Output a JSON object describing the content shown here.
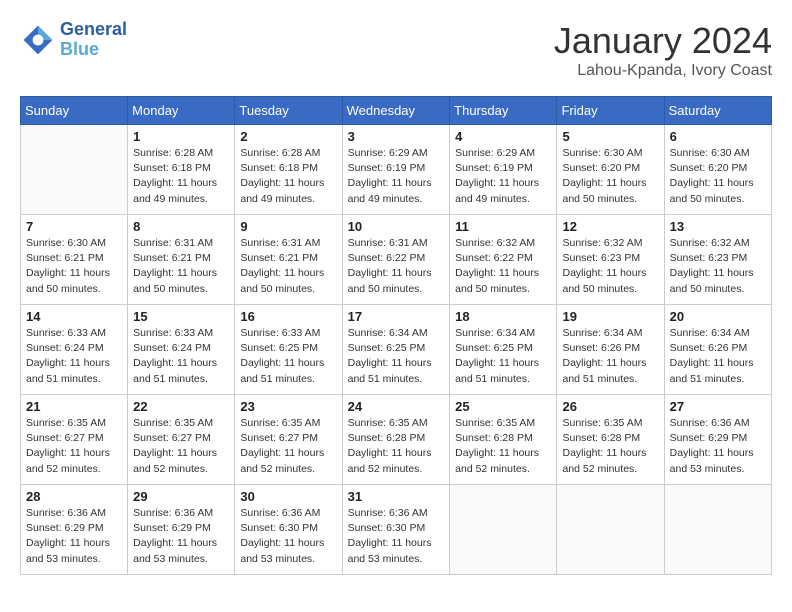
{
  "header": {
    "logo_line1": "General",
    "logo_line2": "Blue",
    "month_title": "January 2024",
    "location": "Lahou-Kpanda, Ivory Coast"
  },
  "weekdays": [
    "Sunday",
    "Monday",
    "Tuesday",
    "Wednesday",
    "Thursday",
    "Friday",
    "Saturday"
  ],
  "weeks": [
    [
      {
        "day": "",
        "info": ""
      },
      {
        "day": "1",
        "info": "Sunrise: 6:28 AM\nSunset: 6:18 PM\nDaylight: 11 hours\nand 49 minutes."
      },
      {
        "day": "2",
        "info": "Sunrise: 6:28 AM\nSunset: 6:18 PM\nDaylight: 11 hours\nand 49 minutes."
      },
      {
        "day": "3",
        "info": "Sunrise: 6:29 AM\nSunset: 6:19 PM\nDaylight: 11 hours\nand 49 minutes."
      },
      {
        "day": "4",
        "info": "Sunrise: 6:29 AM\nSunset: 6:19 PM\nDaylight: 11 hours\nand 49 minutes."
      },
      {
        "day": "5",
        "info": "Sunrise: 6:30 AM\nSunset: 6:20 PM\nDaylight: 11 hours\nand 50 minutes."
      },
      {
        "day": "6",
        "info": "Sunrise: 6:30 AM\nSunset: 6:20 PM\nDaylight: 11 hours\nand 50 minutes."
      }
    ],
    [
      {
        "day": "7",
        "info": "Sunrise: 6:30 AM\nSunset: 6:21 PM\nDaylight: 11 hours\nand 50 minutes."
      },
      {
        "day": "8",
        "info": "Sunrise: 6:31 AM\nSunset: 6:21 PM\nDaylight: 11 hours\nand 50 minutes."
      },
      {
        "day": "9",
        "info": "Sunrise: 6:31 AM\nSunset: 6:21 PM\nDaylight: 11 hours\nand 50 minutes."
      },
      {
        "day": "10",
        "info": "Sunrise: 6:31 AM\nSunset: 6:22 PM\nDaylight: 11 hours\nand 50 minutes."
      },
      {
        "day": "11",
        "info": "Sunrise: 6:32 AM\nSunset: 6:22 PM\nDaylight: 11 hours\nand 50 minutes."
      },
      {
        "day": "12",
        "info": "Sunrise: 6:32 AM\nSunset: 6:23 PM\nDaylight: 11 hours\nand 50 minutes."
      },
      {
        "day": "13",
        "info": "Sunrise: 6:32 AM\nSunset: 6:23 PM\nDaylight: 11 hours\nand 50 minutes."
      }
    ],
    [
      {
        "day": "14",
        "info": "Sunrise: 6:33 AM\nSunset: 6:24 PM\nDaylight: 11 hours\nand 51 minutes."
      },
      {
        "day": "15",
        "info": "Sunrise: 6:33 AM\nSunset: 6:24 PM\nDaylight: 11 hours\nand 51 minutes."
      },
      {
        "day": "16",
        "info": "Sunrise: 6:33 AM\nSunset: 6:25 PM\nDaylight: 11 hours\nand 51 minutes."
      },
      {
        "day": "17",
        "info": "Sunrise: 6:34 AM\nSunset: 6:25 PM\nDaylight: 11 hours\nand 51 minutes."
      },
      {
        "day": "18",
        "info": "Sunrise: 6:34 AM\nSunset: 6:25 PM\nDaylight: 11 hours\nand 51 minutes."
      },
      {
        "day": "19",
        "info": "Sunrise: 6:34 AM\nSunset: 6:26 PM\nDaylight: 11 hours\nand 51 minutes."
      },
      {
        "day": "20",
        "info": "Sunrise: 6:34 AM\nSunset: 6:26 PM\nDaylight: 11 hours\nand 51 minutes."
      }
    ],
    [
      {
        "day": "21",
        "info": "Sunrise: 6:35 AM\nSunset: 6:27 PM\nDaylight: 11 hours\nand 52 minutes."
      },
      {
        "day": "22",
        "info": "Sunrise: 6:35 AM\nSunset: 6:27 PM\nDaylight: 11 hours\nand 52 minutes."
      },
      {
        "day": "23",
        "info": "Sunrise: 6:35 AM\nSunset: 6:27 PM\nDaylight: 11 hours\nand 52 minutes."
      },
      {
        "day": "24",
        "info": "Sunrise: 6:35 AM\nSunset: 6:28 PM\nDaylight: 11 hours\nand 52 minutes."
      },
      {
        "day": "25",
        "info": "Sunrise: 6:35 AM\nSunset: 6:28 PM\nDaylight: 11 hours\nand 52 minutes."
      },
      {
        "day": "26",
        "info": "Sunrise: 6:35 AM\nSunset: 6:28 PM\nDaylight: 11 hours\nand 52 minutes."
      },
      {
        "day": "27",
        "info": "Sunrise: 6:36 AM\nSunset: 6:29 PM\nDaylight: 11 hours\nand 53 minutes."
      }
    ],
    [
      {
        "day": "28",
        "info": "Sunrise: 6:36 AM\nSunset: 6:29 PM\nDaylight: 11 hours\nand 53 minutes."
      },
      {
        "day": "29",
        "info": "Sunrise: 6:36 AM\nSunset: 6:29 PM\nDaylight: 11 hours\nand 53 minutes."
      },
      {
        "day": "30",
        "info": "Sunrise: 6:36 AM\nSunset: 6:30 PM\nDaylight: 11 hours\nand 53 minutes."
      },
      {
        "day": "31",
        "info": "Sunrise: 6:36 AM\nSunset: 6:30 PM\nDaylight: 11 hours\nand 53 minutes."
      },
      {
        "day": "",
        "info": ""
      },
      {
        "day": "",
        "info": ""
      },
      {
        "day": "",
        "info": ""
      }
    ]
  ]
}
